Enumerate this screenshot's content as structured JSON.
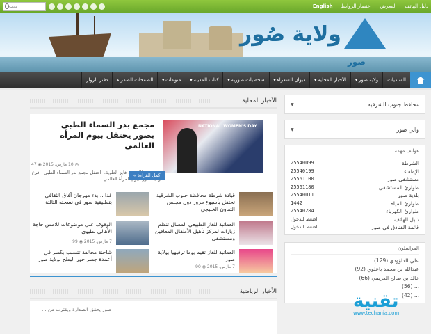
{
  "topbar": {
    "links": [
      "دليل الهاتف",
      "المعرض",
      "اختصار الروابط",
      "English"
    ],
    "search_placeholder": "بحث"
  },
  "banner": {
    "title": "ولاية صُور",
    "logo_text": "صور"
  },
  "nav": {
    "items": [
      {
        "label": "المنتديات",
        "dropdown": false
      },
      {
        "label": "ولاية صور",
        "dropdown": true
      },
      {
        "label": "الأخبار المحلية",
        "dropdown": true
      },
      {
        "label": "ديوان الشعراء",
        "dropdown": true
      },
      {
        "label": "شخصيات صورية",
        "dropdown": true
      },
      {
        "label": "كتاب المدينة",
        "dropdown": true
      },
      {
        "label": "منوعات",
        "dropdown": true
      },
      {
        "label": "الصفحات الصفراء",
        "dropdown": false
      },
      {
        "label": "دفتر الزوار",
        "dropdown": false
      }
    ]
  },
  "sidebar": {
    "select1": "محافظ جنوب الشرقية",
    "select2": "والي صور",
    "phones_title": "هواتف مهمة",
    "phones": [
      {
        "label": "الشرطة",
        "num": "25540099"
      },
      {
        "label": "الإطفاء",
        "num": "25540199"
      },
      {
        "label": "مستشفى صور",
        "num": "25561100"
      },
      {
        "label": "طوارئ المستشفى",
        "num": "25561180"
      },
      {
        "label": "بلدية صور",
        "num": "25540011"
      },
      {
        "label": "طوارئ المياه",
        "num": "1442"
      },
      {
        "label": "طوارئ الكهرباء",
        "num": "25540284"
      },
      {
        "label": "دليل الهاتف",
        "num": "اضغط للدخول"
      },
      {
        "label": "قائمة الفنادق في صور",
        "num": "اضغط للدخول"
      }
    ],
    "corr_title": "المراسلون",
    "correspondents": [
      "علي الداؤودي (129)",
      "عبدالله بن محمد باعلوي (92)",
      "خالد بن صالح العريمي (66)",
      "... (56)",
      "... (42)"
    ]
  },
  "local_news": {
    "heading": "الأخبار المحلية",
    "featured": {
      "title": "مجمع بدر السماء الطبي بصور يحتفل بيوم المرأة العالمي",
      "date": "10 مارس، 2015",
      "views": "47",
      "excerpt": "صور- سطاك بنت فايز العلوية.- احتفل مجمع بدر السماء الطبي - فرع ولاية صور- بيوم المرأة العالمي ...",
      "read_more": "أكمل القراءة »",
      "image_text": "NATIONAL WOMEN'S DAY"
    },
    "items": [
      {
        "title": "قيادة شرطة محافظة جنوب الشرقية تحتفل بأسبوع مرور دول مجلس التعاون الخليجي",
        "meta": ""
      },
      {
        "title": "غدا .. بدء مهرجان آفاق الثقافي بتطبيقية صور في نسخته الثالثة",
        "meta": ""
      },
      {
        "title": "العمانية للغاز الطبيعي المسال تنظم زيارات لمركز تأهيل الأطفال المعاقين ومستشفى",
        "meta": ""
      },
      {
        "title": "الوقوف على موضوعات للامس حاجة الأهالي بطيوي",
        "meta": "7 مارس، 2015 ◉ 99"
      },
      {
        "title": "العمانية للغاز تقيم يوما ترفيهيا بولاية صور",
        "meta": "7 مارس، 2015 ◉ 90"
      },
      {
        "title": "شاحنة مخالفة تتسبب بكسر في أعمدة جسر خور البطح بولاية صور",
        "meta": ""
      }
    ]
  },
  "sports": {
    "heading": "الأخبار الرياضية",
    "excerpt": "صور يحقق الصدارة ويقترب من ..."
  },
  "watermark": {
    "word": "تقنية",
    "url": "www.techania.com"
  }
}
